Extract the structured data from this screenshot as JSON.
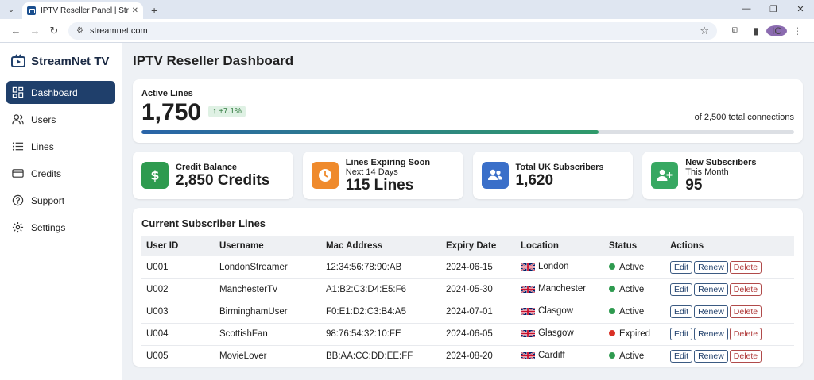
{
  "browser": {
    "tab_title": "IPTV Reseller Panel | StreamNe",
    "url": "streamnet.com",
    "profile_initial": "IC"
  },
  "sidebar": {
    "brand": "StreamNet TV",
    "items": [
      {
        "label": "Dashboard",
        "icon": "dashboard-icon",
        "active": true
      },
      {
        "label": "Users",
        "icon": "users-icon"
      },
      {
        "label": "Lines",
        "icon": "list-icon"
      },
      {
        "label": "Credits",
        "icon": "credit-card-icon"
      },
      {
        "label": "Support",
        "icon": "help-icon"
      },
      {
        "label": "Settings",
        "icon": "gear-icon"
      }
    ]
  },
  "main": {
    "title": "IPTV Reseller Dashboard",
    "active_lines": {
      "label": "Active Lines",
      "value": "1,750",
      "growth": "↑ +7.1%",
      "total_text": "of 2,500 total connections",
      "progress_fraction": 0.7
    },
    "stats": [
      {
        "label": "Credit Balance",
        "sub": "",
        "value": "2,850 Credits",
        "icon": "dollar-icon",
        "color": "#2e9a4f"
      },
      {
        "label": "Lines Expiring Soon",
        "sub": "Next 14 Days",
        "value": "115 Lines",
        "icon": "clock-icon",
        "color": "#ef8a2c"
      },
      {
        "label": "Total UK Subscribers",
        "sub": "",
        "value": "1,620",
        "icon": "group-icon",
        "color": "#3a6fc9"
      },
      {
        "label": "New Subscribers",
        "sub": "This Month",
        "value": "95",
        "icon": "add-user-icon",
        "color": "#37a862"
      }
    ],
    "table": {
      "title": "Current Subscriber Lines",
      "headers": [
        "User ID",
        "Username",
        "Mac Address",
        "Expiry Date",
        "Location",
        "Status",
        "Actions"
      ],
      "rows": [
        {
          "id": "U001",
          "username": "LondonStreamer",
          "mac": "12:34:56:78:90:AB",
          "expiry": "2024-06-15",
          "location": "London",
          "status": "Active"
        },
        {
          "id": "U002",
          "username": "ManchesterTv",
          "mac": "A1:B2:C3:D4:E5:F6",
          "expiry": "2024-05-30",
          "location": "Manchester",
          "status": "Active"
        },
        {
          "id": "U003",
          "username": "BirminghamUser",
          "mac": "F0:E1:D2:C3:B4:A5",
          "expiry": "2024-07-01",
          "location": "Clasgow",
          "status": "Active"
        },
        {
          "id": "U004",
          "username": "ScottishFan",
          "mac": "98:76:54:32:10:FE",
          "expiry": "2024-06-05",
          "location": "Glasgow",
          "status": "Expired"
        },
        {
          "id": "U005",
          "username": "MovieLover",
          "mac": "BB:AA:CC:DD:EE:FF",
          "expiry": "2024-08-20",
          "location": "Cardiff",
          "status": "Active"
        }
      ],
      "actions": {
        "edit": "Edit",
        "renew": "Renew",
        "delete": "Delete"
      },
      "status_colors": {
        "Active": "#2e9a4f",
        "Expired": "#d93025"
      }
    }
  }
}
